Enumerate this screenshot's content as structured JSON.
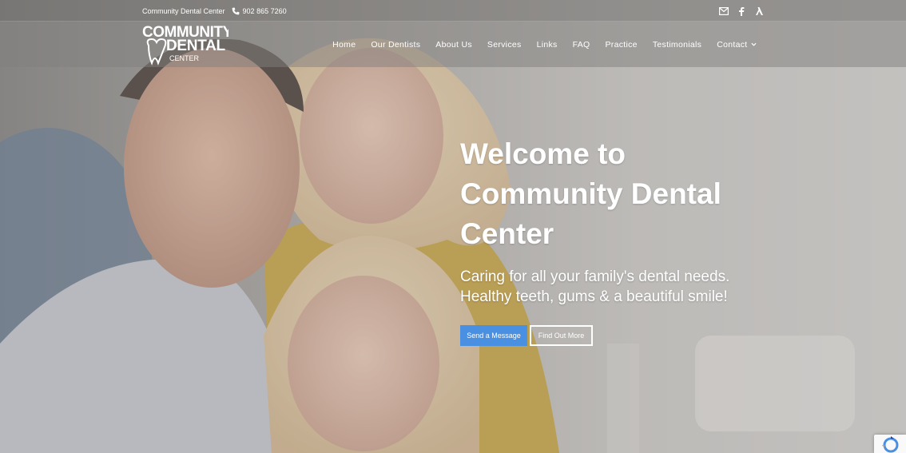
{
  "topbar": {
    "company_name": "Community Dental Center",
    "phone": "902 865 7260",
    "icons": [
      "envelope-icon",
      "facebook-icon",
      "yelp-icon"
    ]
  },
  "logo": {
    "line1": "COMMUNITY",
    "line2": "DENTAL",
    "line3": "CENTER"
  },
  "nav": {
    "items": [
      {
        "label": "Home"
      },
      {
        "label": "Our Dentists"
      },
      {
        "label": "About Us"
      },
      {
        "label": "Services"
      },
      {
        "label": "Links"
      },
      {
        "label": "FAQ"
      },
      {
        "label": "Practice"
      },
      {
        "label": "Testimonials"
      },
      {
        "label": "Contact",
        "has_dropdown": true
      }
    ]
  },
  "hero": {
    "title_line1": "Welcome to",
    "title_line2": "Community Dental",
    "title_line3": "Center",
    "subtitle_line1": "Caring for all your family's dental needs.",
    "subtitle_line2": "Healthy teeth, gums & a beautiful smile!",
    "primary_button": "Send a Message",
    "secondary_button": "Find Out More"
  },
  "colors": {
    "accent": "#4a90e2",
    "text": "#ffffff"
  }
}
